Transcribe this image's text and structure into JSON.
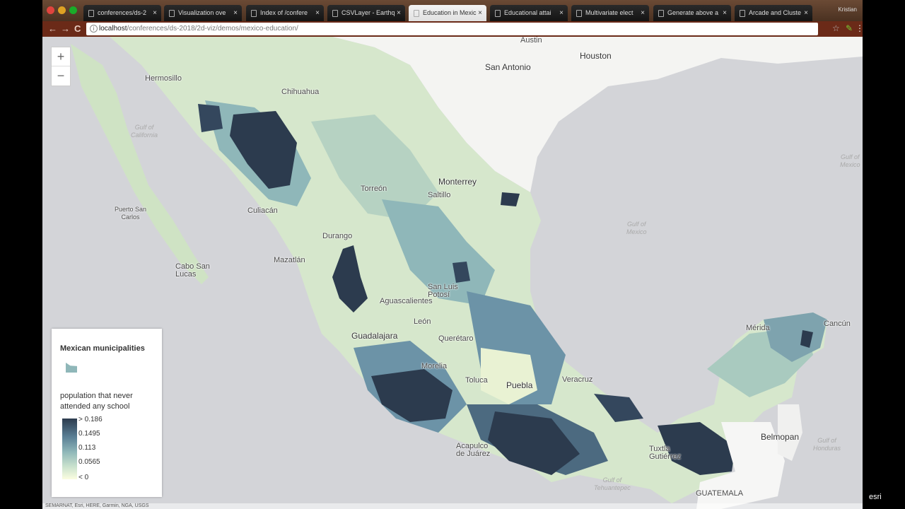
{
  "browser": {
    "tabs": [
      {
        "label": "conferences/ds-2",
        "active": false
      },
      {
        "label": "Visualization ove",
        "active": false
      },
      {
        "label": "Index of /confere",
        "active": false
      },
      {
        "label": "CSVLayer - Earthq",
        "active": false
      },
      {
        "label": "Education in Mexic",
        "active": true
      },
      {
        "label": "Educational attai",
        "active": false
      },
      {
        "label": "Multivariate elect",
        "active": false
      },
      {
        "label": "Generate above a",
        "active": false
      },
      {
        "label": "Arcade and Cluste",
        "active": false
      }
    ],
    "close_glyph": "×",
    "user": "Kristian",
    "url_host": "localhost",
    "url_path": "/conferences/ds-2018/2d-viz/demos/mexico-education/",
    "back_glyph": "←",
    "forward_glyph": "→",
    "reload_glyph": "C",
    "info_glyph": "i"
  },
  "map": {
    "zoom_in": "+",
    "zoom_out": "−",
    "labels": {
      "austin": "Austin",
      "houston": "Houston",
      "san_antonio": "San Antonio",
      "hermosillo": "Hermosillo",
      "chihuahua": "Chihuahua",
      "gulf_california": "Gulf of\nCalifornia",
      "monterrey": "Monterrey",
      "torreon": "Torreón",
      "saltillo": "Saltillo",
      "puerto_san_carlos": "Puerto San\nCarlos",
      "culiacan": "Culiacán",
      "durango": "Durango",
      "gulf_mexico_left": "Gulf of\nMexico",
      "gulf_mexico_right": "Gulf of\nMexico",
      "mazatlan": "Mazatlán",
      "cabo": "Cabo San\nLucas",
      "slp": "San Luis\nPotosí",
      "aguascalientes": "Aguascalientes",
      "leon": "León",
      "guadalajara": "Guadalajara",
      "queretaro": "Querétaro",
      "merida": "Mérida",
      "cancun": "Cancún",
      "morelia": "Morelia",
      "toluca": "Toluca",
      "puebla": "Puebla",
      "veracruz": "Veracruz",
      "acapulco": "Acapulco\nde Juárez",
      "tuxtla": "Tuxtla\nGutiérrez",
      "belmopan": "Belmopan",
      "gulf_honduras": "Gulf of\nHonduras",
      "gulf_tehuantepec": "Gulf of\nTehuantepec",
      "guatemala": "GUATEMALA"
    },
    "attribution": "SEMARNAT, Esri, HERE, Garmin, NGA, USGS",
    "powered_by": "esri"
  },
  "legend": {
    "layer_title": "Mexican municipalities",
    "field_label": "population that never attended any school",
    "stops": [
      "> 0.186",
      "0.1495",
      "0.113",
      "0.0565",
      "< 0"
    ]
  },
  "colors": {
    "low": "#fbfde0",
    "mid": "#8fb7b9",
    "high": "#2c3b4e",
    "water": "#d3d4d8",
    "land": "#f5f5f3"
  }
}
